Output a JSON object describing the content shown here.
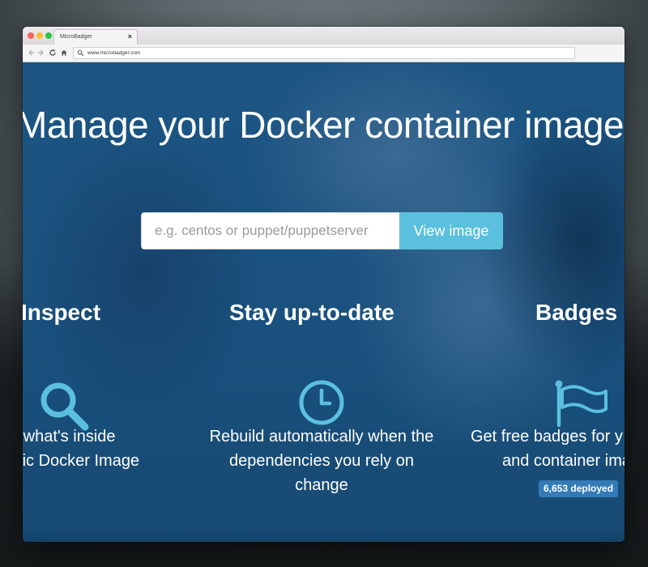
{
  "browser": {
    "tab_title": "MicroBadger",
    "tab_close": "×",
    "url": "www.microbadger.com"
  },
  "hero": {
    "title": "Manage your Docker container images"
  },
  "search": {
    "placeholder": "e.g. centos or puppet/puppetserver",
    "button_label": "View image"
  },
  "features": {
    "inspect": {
      "title": "Inspect",
      "icon": "search-icon",
      "line1": "e what's inside",
      "line2": "blic Docker Image"
    },
    "update": {
      "title": "Stay up-to-date",
      "icon": "clock-icon",
      "line1": "Rebuild automatically when the",
      "line2": "dependencies you rely on",
      "line3": "change"
    },
    "badges": {
      "title": "Badges",
      "icon": "flag-icon",
      "line1": "Get free badges for y",
      "line2": "and container ima",
      "count": "6,653 deployed"
    }
  },
  "colors": {
    "accent": "#5bc0de",
    "badge": "#337ab7",
    "background": "#1a4f7c"
  }
}
